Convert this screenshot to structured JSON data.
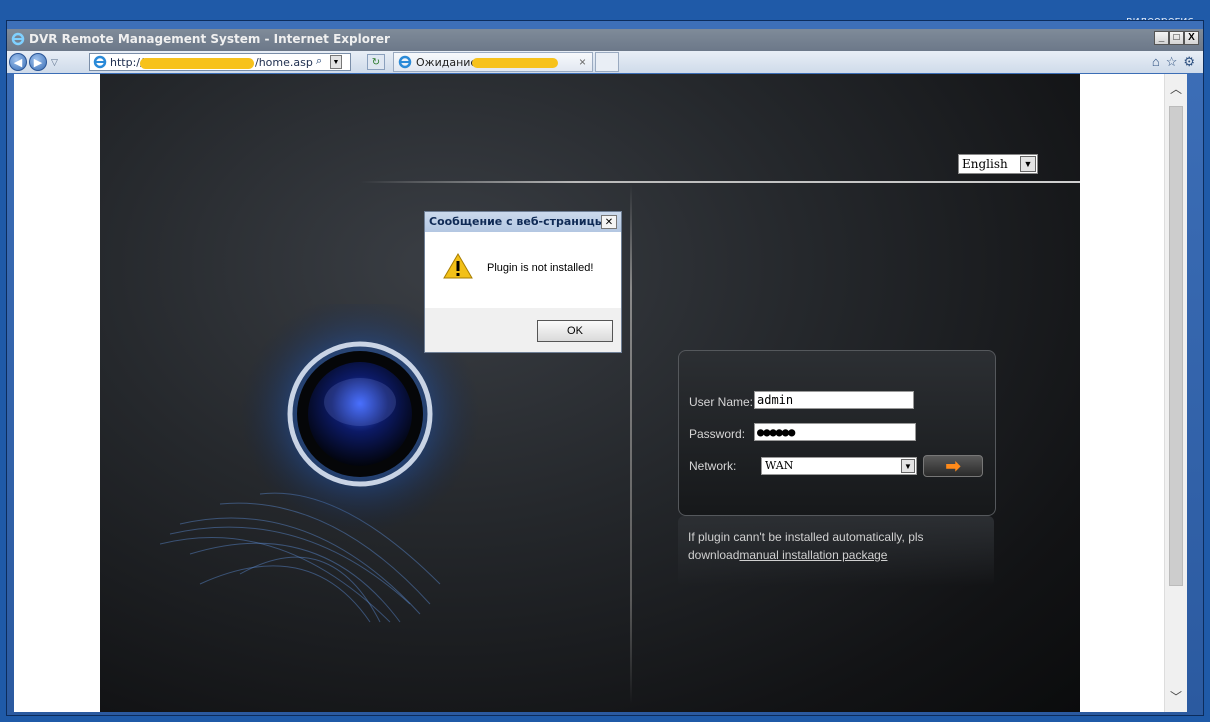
{
  "corner_text": "видеорегис...",
  "window": {
    "title": "DVR Remote Management System - Internet Explorer",
    "minimize": "_",
    "maximize": "□",
    "close": "X"
  },
  "navbar": {
    "address_prefix": "http://",
    "address_suffix": "/home.asp",
    "tab_label": "Ожидание",
    "tab_close": "×"
  },
  "page": {
    "language": "English",
    "login": {
      "username_label": "User Name:",
      "username_value": "admin",
      "password_label": "Password:",
      "password_value": "●●●●●●",
      "network_label": "Network:",
      "network_value": "WAN"
    },
    "info": {
      "text": "If plugin cann't be installed automatically, pls download",
      "link": "manual installation package"
    }
  },
  "dialog": {
    "title": "Сообщение с веб-страницы",
    "message": "Plugin is not installed!",
    "ok": "OK"
  },
  "icons": [
    "ie-icon",
    "back-icon",
    "forward-icon",
    "search-icon",
    "refresh-icon",
    "home-icon",
    "star-icon",
    "gear-icon",
    "warning-icon",
    "arrow-right-icon"
  ]
}
